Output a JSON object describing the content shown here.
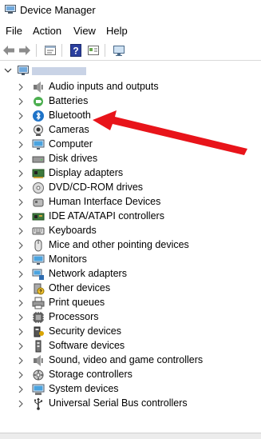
{
  "window": {
    "title": "Device Manager"
  },
  "menu": [
    {
      "label": "File"
    },
    {
      "label": "Action"
    },
    {
      "label": "View"
    },
    {
      "label": "Help"
    }
  ],
  "toolbar": [
    {
      "icon": "back-arrow-icon"
    },
    {
      "icon": "forward-arrow-icon"
    },
    {
      "icon": "properties-icon"
    },
    {
      "icon": "help-icon"
    },
    {
      "icon": "update-driver-icon"
    },
    {
      "icon": "scan-monitor-icon"
    }
  ],
  "tree": {
    "root": {
      "icon": "computer-icon",
      "label_redacted": true
    },
    "categories": [
      {
        "label": "Audio inputs and outputs",
        "icon": "speaker-icon"
      },
      {
        "label": "Batteries",
        "icon": "battery-icon"
      },
      {
        "label": "Bluetooth",
        "icon": "bluetooth-icon"
      },
      {
        "label": "Cameras",
        "icon": "camera-icon"
      },
      {
        "label": "Computer",
        "icon": "monitor-icon"
      },
      {
        "label": "Disk drives",
        "icon": "disk-drive-icon"
      },
      {
        "label": "Display adapters",
        "icon": "display-adapter-icon"
      },
      {
        "label": "DVD/CD-ROM drives",
        "icon": "dvd-drive-icon"
      },
      {
        "label": "Human Interface Devices",
        "icon": "hid-icon"
      },
      {
        "label": "IDE ATA/ATAPI controllers",
        "icon": "ide-controller-icon"
      },
      {
        "label": "Keyboards",
        "icon": "keyboard-icon"
      },
      {
        "label": "Mice and other pointing devices",
        "icon": "mouse-icon"
      },
      {
        "label": "Monitors",
        "icon": "monitor-icon"
      },
      {
        "label": "Network adapters",
        "icon": "network-adapter-icon"
      },
      {
        "label": "Other devices",
        "icon": "unknown-device-icon"
      },
      {
        "label": "Print queues",
        "icon": "printer-icon"
      },
      {
        "label": "Processors",
        "icon": "processor-icon"
      },
      {
        "label": "Security devices",
        "icon": "security-device-icon"
      },
      {
        "label": "Software devices",
        "icon": "software-device-icon"
      },
      {
        "label": "Sound, video and game controllers",
        "icon": "sound-controller-icon"
      },
      {
        "label": "Storage controllers",
        "icon": "storage-controller-icon"
      },
      {
        "label": "System devices",
        "icon": "system-device-icon"
      },
      {
        "label": "Universal Serial Bus controllers",
        "icon": "usb-icon"
      }
    ]
  },
  "annotation": {
    "type": "arrow",
    "color": "#e8141a",
    "points_to": "Bluetooth"
  }
}
